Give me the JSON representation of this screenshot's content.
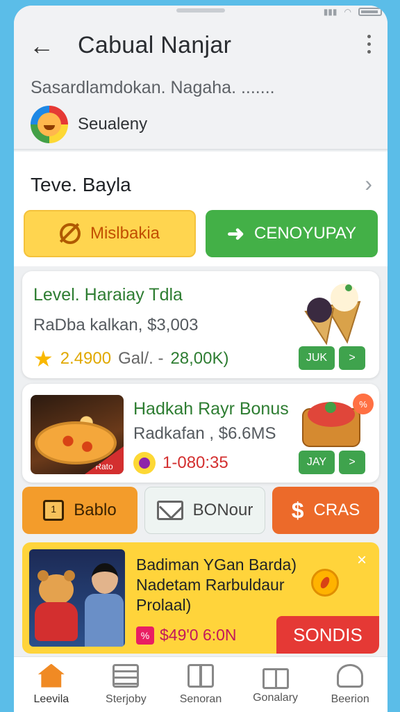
{
  "app": {
    "title": "Cabual Nanjar",
    "subtitle": "Sasardlamdokan. Nagaha. .......",
    "brand": "Seualeny"
  },
  "section": {
    "title": "Teve. Bayla",
    "btn_left": "Mislbakia",
    "btn_right": "CENOYUPAY"
  },
  "card1": {
    "title": "Level. Haraiay Tdla",
    "subtitle": "RaDba kalkan, $3,003",
    "rating": "2.4900",
    "stats_mid": "Gal/. -",
    "stats_value": "28,00K)",
    "btn1": "JUK",
    "btn2": ">"
  },
  "card2": {
    "title": "Hadkah Rayr Bonus",
    "subtitle": "Radkafan , $6.6MS",
    "timer": "1-080:35",
    "btn1": "JAY",
    "btn2": ">",
    "badge": "%",
    "image_tag": "Rato"
  },
  "row_buttons": {
    "b1": "Bablo",
    "b2": "BONour",
    "b3": "CRAS",
    "b3_icon": "$"
  },
  "promo": {
    "text": "Badiman YGan Barda) Nadetam Rarbuldaur Prolaal)",
    "price": "$49'0 6:0N",
    "price_icon": "%",
    "cta": "SONDIS",
    "close": "×"
  },
  "nav": [
    {
      "label": "Leevila",
      "icon": "home-icon"
    },
    {
      "label": "Sterjoby",
      "icon": "list-icon"
    },
    {
      "label": "Senoran",
      "icon": "box-icon"
    },
    {
      "label": "Gonalary",
      "icon": "gift-icon"
    },
    {
      "label": "Beerion",
      "icon": "bag-icon"
    }
  ],
  "colors": {
    "accent_green": "#43b047",
    "accent_orange": "#f39c2b",
    "promo_yellow": "#ffd43b",
    "cta_red": "#e53935"
  }
}
